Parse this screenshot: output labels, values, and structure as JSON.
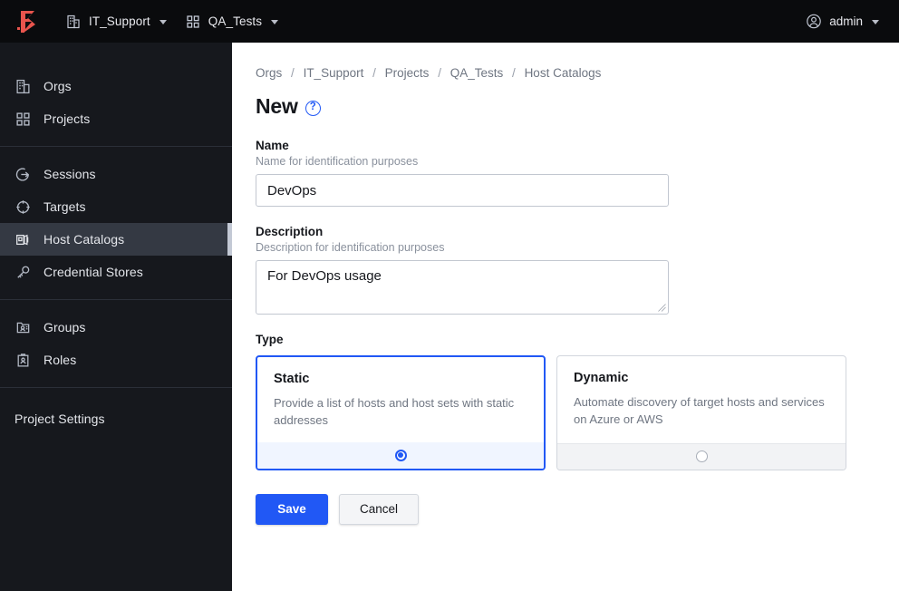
{
  "topbar": {
    "logo_name": "boundary-logo",
    "logo_color": "#e8544d",
    "org_selector": {
      "label": "IT_Support",
      "icon": "building-icon"
    },
    "project_selector": {
      "label": "QA_Tests",
      "icon": "grid-icon"
    },
    "user_menu": {
      "label": "admin",
      "icon": "user-circle-icon"
    }
  },
  "sidebar": {
    "groups": [
      {
        "items": [
          {
            "label": "Orgs",
            "icon": "building-icon",
            "active": false
          },
          {
            "label": "Projects",
            "icon": "grid-icon",
            "active": false
          }
        ]
      },
      {
        "items": [
          {
            "label": "Sessions",
            "icon": "session-arrow-icon",
            "active": false
          },
          {
            "label": "Targets",
            "icon": "target-icon",
            "active": false
          },
          {
            "label": "Host Catalogs",
            "icon": "host-catalog-icon",
            "active": true
          },
          {
            "label": "Credential Stores",
            "icon": "key-icon",
            "active": false
          }
        ]
      },
      {
        "items": [
          {
            "label": "Groups",
            "icon": "groups-icon",
            "active": false
          },
          {
            "label": "Roles",
            "icon": "roles-id-icon",
            "active": false
          }
        ]
      }
    ],
    "settings_label": "Project Settings",
    "active_indicator_color": "#c3c9d5",
    "active_background": "#343943",
    "background": "#16181d"
  },
  "main": {
    "breadcrumb": [
      {
        "label": "Orgs"
      },
      {
        "label": "IT_Support"
      },
      {
        "label": "Projects"
      },
      {
        "label": "QA_Tests"
      },
      {
        "label": "Host Catalogs"
      }
    ],
    "breadcrumb_separator": "/",
    "page_title": "New",
    "help_icon_glyph": "?",
    "name_field": {
      "label": "Name",
      "help": "Name for identification purposes",
      "value": "DevOps",
      "placeholder": "Name"
    },
    "description_field": {
      "label": "Description",
      "help": "Description for identification purposes",
      "value": "For DevOps usage",
      "placeholder": "Description"
    },
    "type_section": {
      "label": "Type",
      "options": [
        {
          "title": "Static",
          "description": "Provide a list of hosts and host sets with static addresses",
          "selected": true
        },
        {
          "title": "Dynamic",
          "description": "Automate discovery of target hosts and services on Azure or AWS",
          "selected": false
        }
      ]
    },
    "actions": {
      "save_label": "Save",
      "cancel_label": "Cancel"
    }
  },
  "colors": {
    "accent_blue": "#2158f5",
    "selected_card_bg": "#f0f5ff",
    "unselected_card_bg": "#f2f3f5",
    "topbar_bg": "#0a0b0d"
  }
}
